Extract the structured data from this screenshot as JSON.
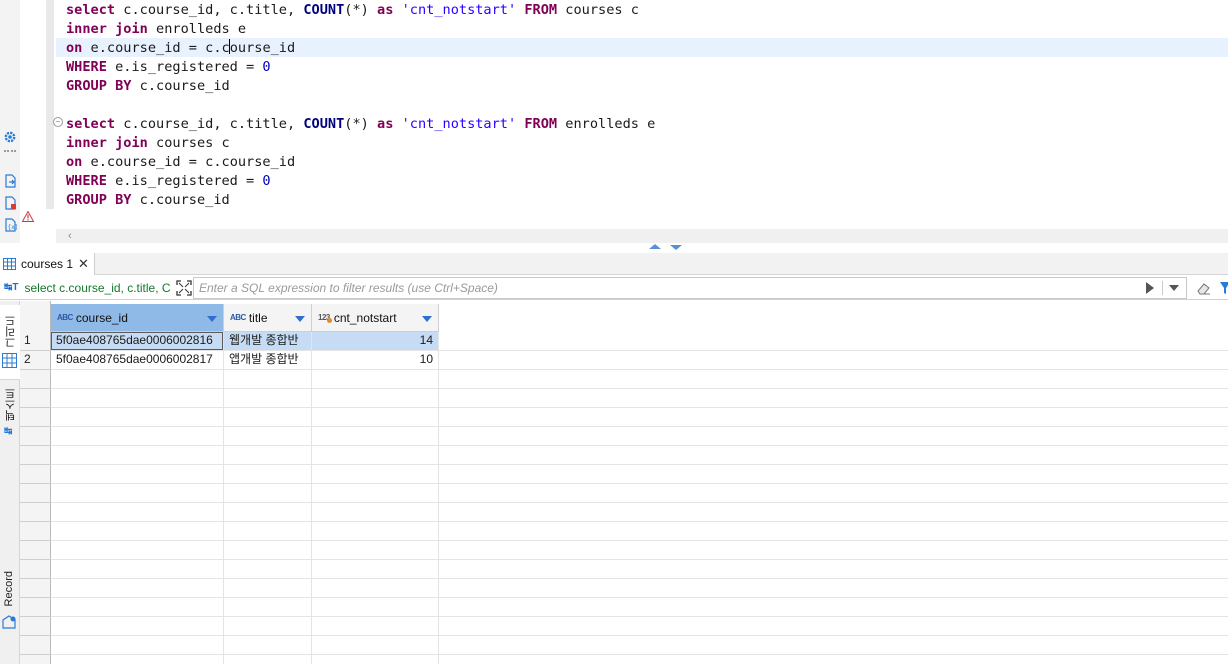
{
  "editor": {
    "query1": {
      "line1": {
        "kw_select": "select",
        "cols_a": " c.course_id, c.title, ",
        "count": "COUNT",
        "paren": "(*) ",
        "as": "as",
        "alias": "'cnt_notstart'",
        "from": "FROM",
        "table": " courses c"
      },
      "line2": {
        "kw": "inner join",
        "rest": " enrolleds e"
      },
      "line3": {
        "kw": "on",
        "rest_a": " e.course_id = c.c",
        "rest_b": "ourse_id"
      },
      "line4": {
        "kw": "WHERE",
        "rest": " e.is_registered = ",
        "num": "0"
      },
      "line5": {
        "kw": "GROUP BY",
        "rest": " c.course_id"
      }
    },
    "query2": {
      "line1": {
        "kw_select": "select",
        "cols_a": " c.course_id, c.title, ",
        "count": "COUNT",
        "paren": "(*) ",
        "as": "as",
        "alias": "'cnt_notstart'",
        "from": "FROM",
        "table": " enrolleds e"
      },
      "line2": {
        "kw": "inner join",
        "rest": " courses c"
      },
      "line3": {
        "kw": "on",
        "rest": " e.course_id = c.course_id"
      },
      "line4": {
        "kw": "WHERE",
        "rest": " e.is_registered = ",
        "num": "0"
      },
      "line5": {
        "kw": "GROUP BY",
        "rest": " c.course_id"
      }
    }
  },
  "results": {
    "tab_label": "courses 1",
    "query_preview": "select c.course_id, c.title, C",
    "filter_placeholder": "Enter a SQL expression to filter results (use Ctrl+Space)",
    "side_tabs": {
      "grid": "그리드",
      "text": "텍스트",
      "record": "Record"
    },
    "columns": [
      {
        "type": "ABC",
        "label": "course_id"
      },
      {
        "type": "ABC",
        "label": "title"
      },
      {
        "type": "123",
        "label": "cnt_notstart"
      }
    ],
    "rows": [
      {
        "num": "1",
        "course_id": "5f0ae408765dae0006002816",
        "title": "웹개발 종합반",
        "cnt_notstart": "14"
      },
      {
        "num": "2",
        "course_id": "5f0ae408765dae0006002817",
        "title": "앱개발 종합반",
        "cnt_notstart": "10"
      }
    ]
  }
}
